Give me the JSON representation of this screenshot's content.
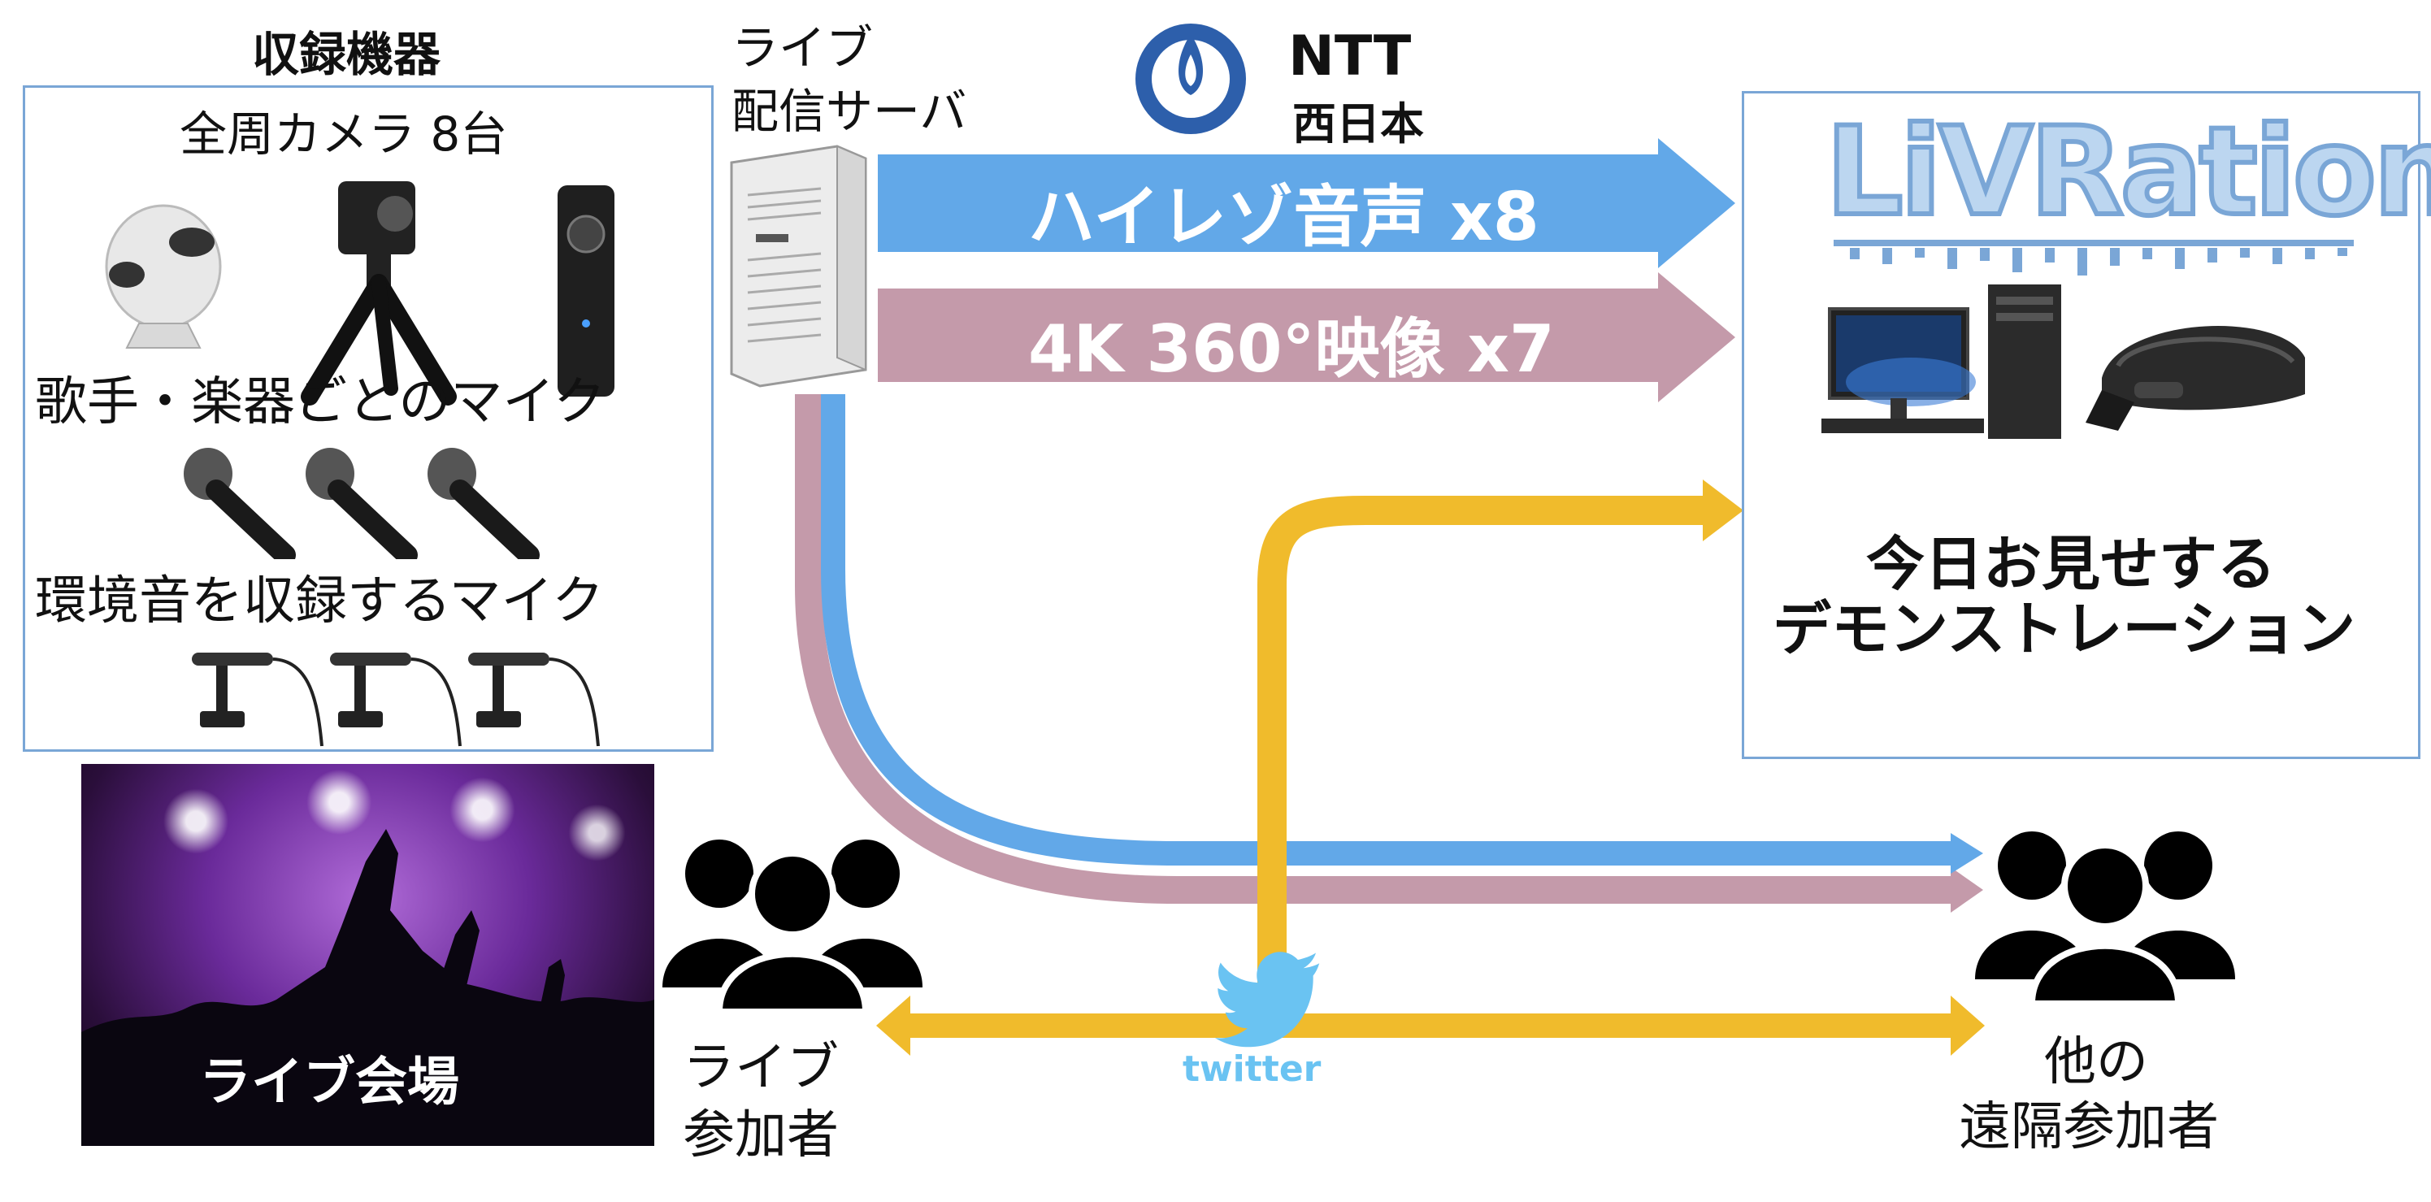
{
  "equipment": {
    "title": "収録機器",
    "cameras_label": "全周カメラ 8台",
    "vocal_mics_label": "歌手・楽器ごとのマイク",
    "ambient_mics_label": "環境音を収録するマイク"
  },
  "server": {
    "label_line1": "ライブ",
    "label_line2": "配信サーバ"
  },
  "ntt": {
    "name": "NTT",
    "sub": "西日本",
    "color": "#2d5fab"
  },
  "arrows": {
    "audio_label": "ハイレゾ音声 x8",
    "video_label": "4K 360°映像 x7",
    "audio_color": "#62a8e8",
    "video_color": "#c49aaa",
    "social_color": "#f0bb2c"
  },
  "livration": {
    "logo": "LiVRation",
    "demo_line1": "今日お見せする",
    "demo_line2": "デモンストレーション",
    "logo_color": "#7aa6d6",
    "logo_accent": "#e23a3a"
  },
  "venue": {
    "label": "ライブ会場"
  },
  "participants": {
    "local_line1": "ライブ",
    "local_line2": "参加者",
    "remote_line1": "他の",
    "remote_line2": "遠隔参加者"
  },
  "twitter": {
    "label": "twitter",
    "color": "#6ac3f2"
  }
}
